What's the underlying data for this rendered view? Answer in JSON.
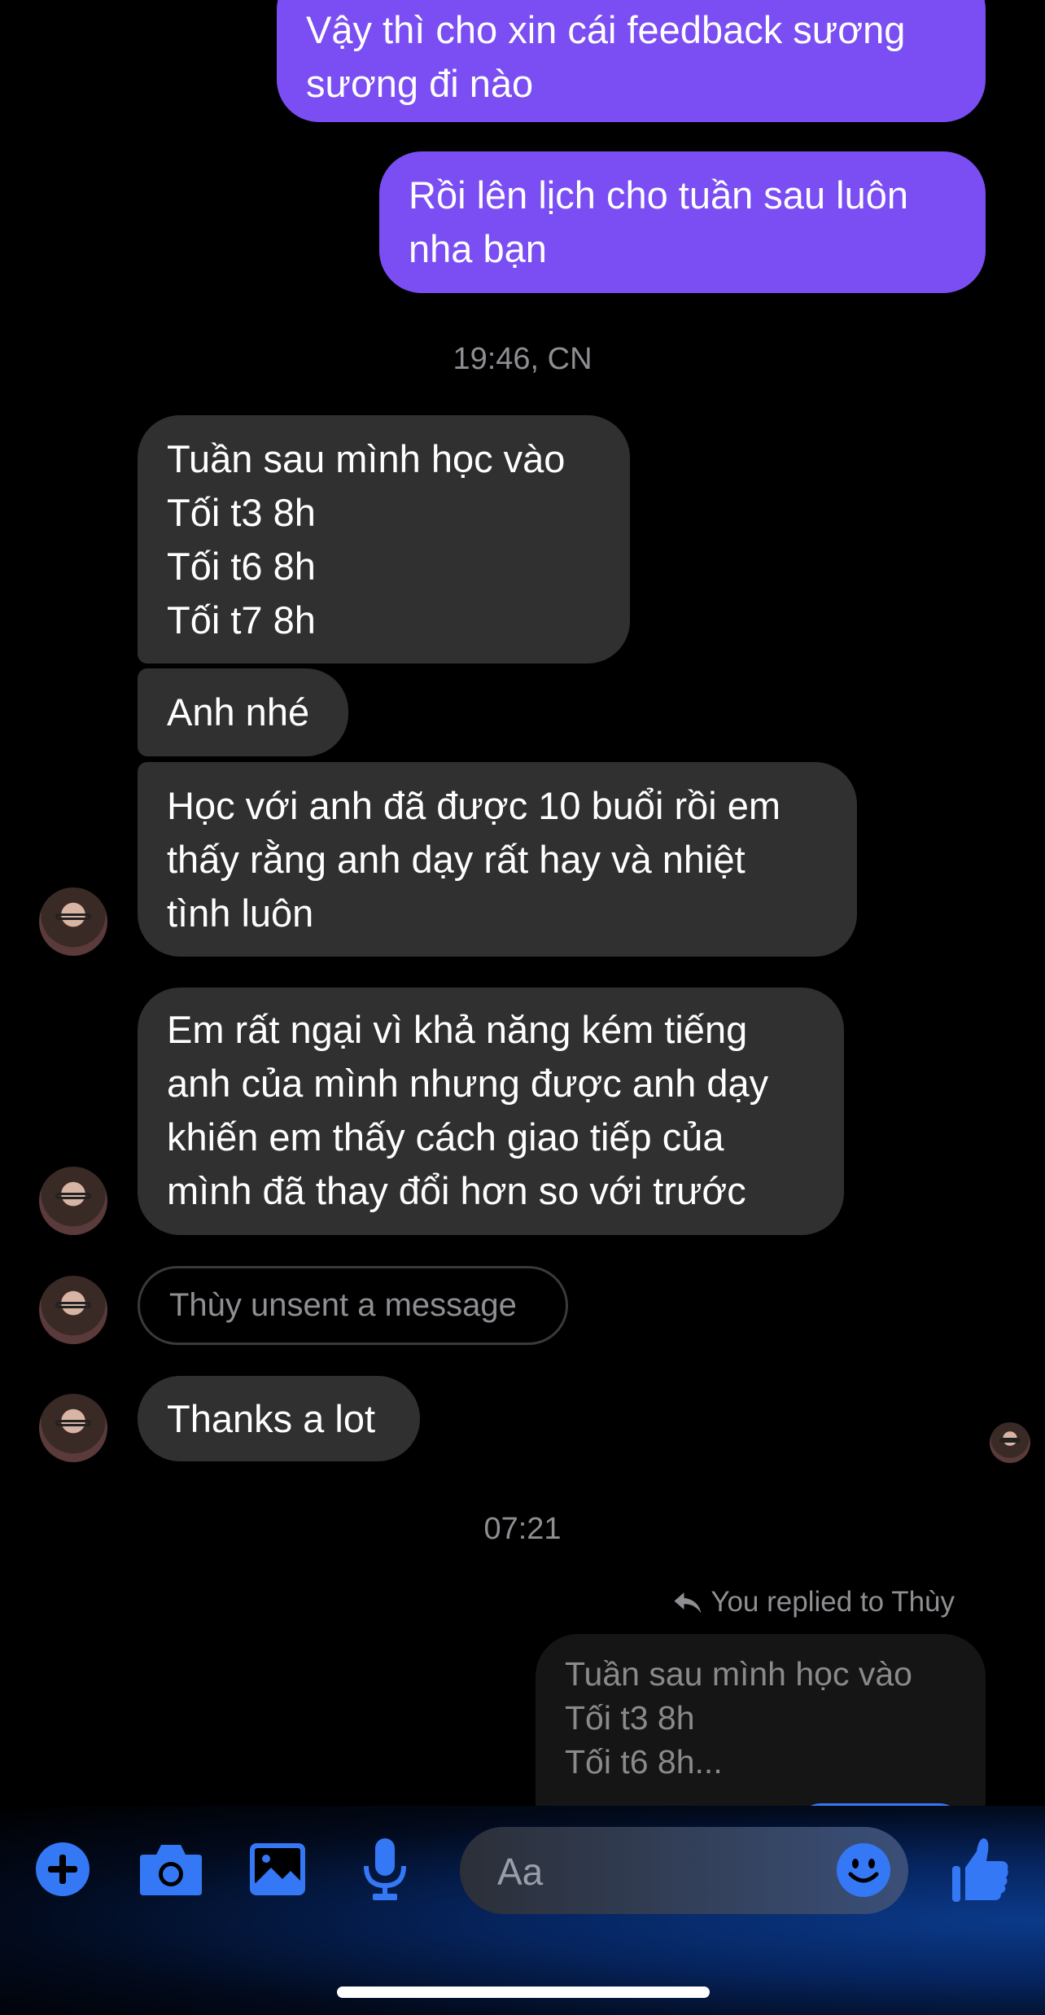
{
  "messages": {
    "sent1": "Vậy thì cho xin cái feedback sương\nsương đi nào",
    "sent2": "Rồi lên lịch cho tuần sau luôn\nnha bạn",
    "timestamp1": "19:46, CN",
    "recv1": "Tuần sau mình học vào\nTối t3 8h\nTối t6 8h\nTối t7 8h",
    "recv2": "Anh nhé",
    "recv3": "Học với anh đã được 10 buổi rồi em\nthấy rằng anh dạy rất hay và nhiệt\ntình luôn",
    "recv4": "Em rất ngại vì khả năng kém tiếng\nanh của mình nhưng được anh dạy\nkhiến em thấy cách giao tiếp của\nmình đã thay đổi hơn so với trước",
    "unsent": "Thùy unsent a message",
    "recv5": "Thanks a lot",
    "timestamp2": "07:21",
    "reply_label": "You replied to Thùy",
    "reply_quote": "Tuần sau mình học vào\nTối t3 8h\nTối t6 8h..."
  },
  "composer": {
    "placeholder": "Aa",
    "icons": [
      "plus-icon",
      "camera-icon",
      "image-icon",
      "microphone-icon",
      "emoji-icon",
      "thumbs-up-icon"
    ]
  },
  "colors": {
    "sent_bubble": "#7a4ef2",
    "received_bubble": "#303030",
    "accent": "#3478f6",
    "background": "#000000"
  }
}
